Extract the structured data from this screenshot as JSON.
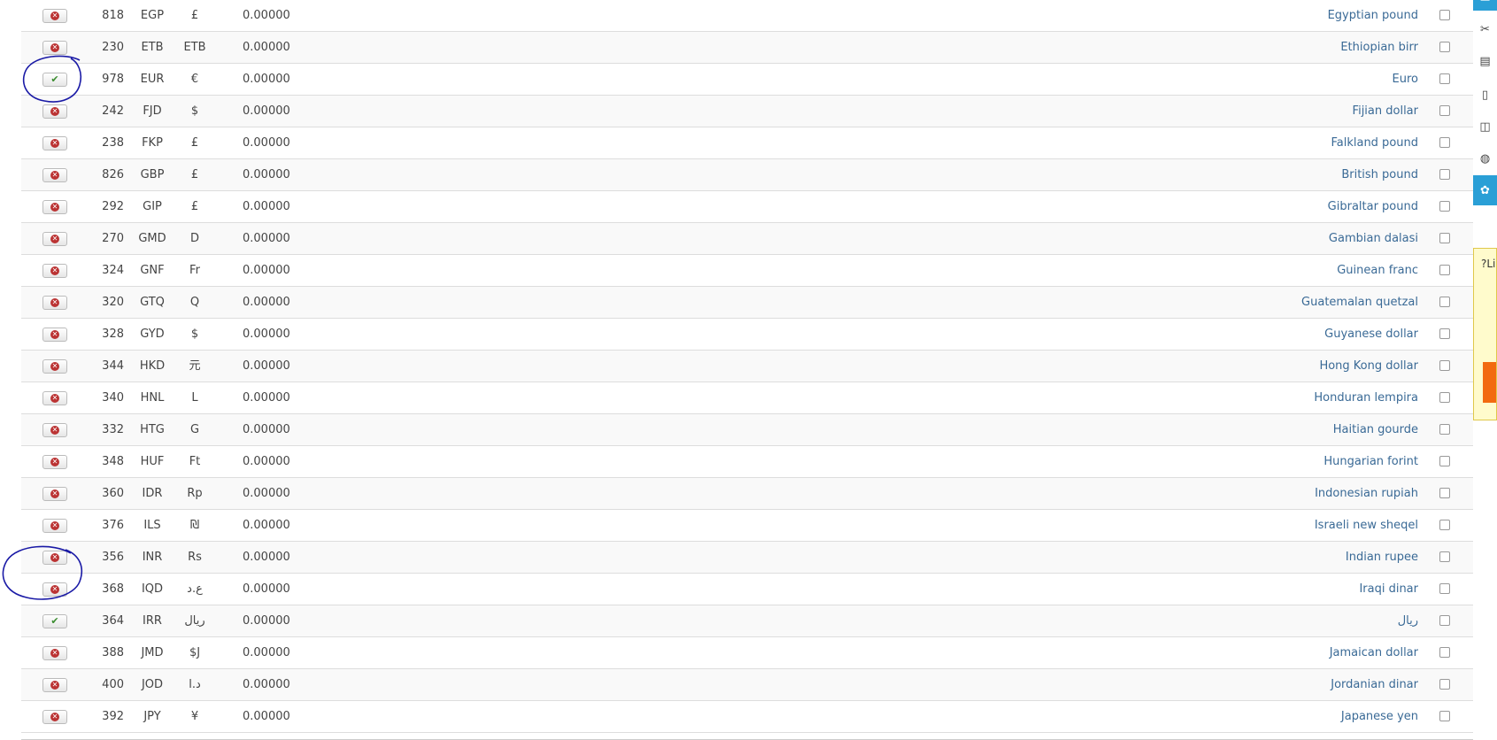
{
  "rows": [
    {
      "num": "818",
      "code": "EGP",
      "symbol": "£",
      "rate": "0.00000",
      "name": "Egyptian pound",
      "enabled": false
    },
    {
      "num": "230",
      "code": "ETB",
      "symbol": "ETB",
      "rate": "0.00000",
      "name": "Ethiopian birr",
      "enabled": false
    },
    {
      "num": "978",
      "code": "EUR",
      "symbol": "€",
      "rate": "0.00000",
      "name": "Euro",
      "enabled": true
    },
    {
      "num": "242",
      "code": "FJD",
      "symbol": "$",
      "rate": "0.00000",
      "name": "Fijian dollar",
      "enabled": false
    },
    {
      "num": "238",
      "code": "FKP",
      "symbol": "£",
      "rate": "0.00000",
      "name": "Falkland pound",
      "enabled": false
    },
    {
      "num": "826",
      "code": "GBP",
      "symbol": "£",
      "rate": "0.00000",
      "name": "British pound",
      "enabled": false
    },
    {
      "num": "292",
      "code": "GIP",
      "symbol": "£",
      "rate": "0.00000",
      "name": "Gibraltar pound",
      "enabled": false
    },
    {
      "num": "270",
      "code": "GMD",
      "symbol": "D",
      "rate": "0.00000",
      "name": "Gambian dalasi",
      "enabled": false
    },
    {
      "num": "324",
      "code": "GNF",
      "symbol": "Fr",
      "rate": "0.00000",
      "name": "Guinean franc",
      "enabled": false
    },
    {
      "num": "320",
      "code": "GTQ",
      "symbol": "Q",
      "rate": "0.00000",
      "name": "Guatemalan quetzal",
      "enabled": false
    },
    {
      "num": "328",
      "code": "GYD",
      "symbol": "$",
      "rate": "0.00000",
      "name": "Guyanese dollar",
      "enabled": false
    },
    {
      "num": "344",
      "code": "HKD",
      "symbol": "元",
      "rate": "0.00000",
      "name": "Hong Kong dollar",
      "enabled": false
    },
    {
      "num": "340",
      "code": "HNL",
      "symbol": "L",
      "rate": "0.00000",
      "name": "Honduran lempira",
      "enabled": false
    },
    {
      "num": "332",
      "code": "HTG",
      "symbol": "G",
      "rate": "0.00000",
      "name": "Haitian gourde",
      "enabled": false
    },
    {
      "num": "348",
      "code": "HUF",
      "symbol": "Ft",
      "rate": "0.00000",
      "name": "Hungarian forint",
      "enabled": false
    },
    {
      "num": "360",
      "code": "IDR",
      "symbol": "Rp",
      "rate": "0.00000",
      "name": "Indonesian rupiah",
      "enabled": false
    },
    {
      "num": "376",
      "code": "ILS",
      "symbol": "₪",
      "rate": "0.00000",
      "name": "Israeli new sheqel",
      "enabled": false
    },
    {
      "num": "356",
      "code": "INR",
      "symbol": "Rs",
      "rate": "0.00000",
      "name": "Indian rupee",
      "enabled": false
    },
    {
      "num": "368",
      "code": "IQD",
      "symbol": "ع.د",
      "rate": "0.00000",
      "name": "Iraqi dinar",
      "enabled": false
    },
    {
      "num": "364",
      "code": "IRR",
      "symbol": "ریال",
      "rate": "0.00000",
      "name": "ریال",
      "enabled": true
    },
    {
      "num": "388",
      "code": "JMD",
      "symbol": "$J",
      "rate": "0.00000",
      "name": "Jamaican dollar",
      "enabled": false
    },
    {
      "num": "400",
      "code": "JOD",
      "symbol": "د.ا",
      "rate": "0.00000",
      "name": "Jordanian dinar",
      "enabled": false
    },
    {
      "num": "392",
      "code": "JPY",
      "symbol": "¥",
      "rate": "0.00000",
      "name": "Japanese yen",
      "enabled": false
    }
  ],
  "side_icons": [
    "dashboard-icon",
    "tools-icon",
    "chart-icon",
    "document-icon",
    "coins-icon",
    "globe-icon",
    "settings-icon"
  ],
  "promo": {
    "text": "?Li"
  },
  "colors": {
    "accent": "#2a9fd6",
    "link": "#3a6a96",
    "annotation": "#1a1aa6",
    "promo_button": "#f26a10"
  }
}
